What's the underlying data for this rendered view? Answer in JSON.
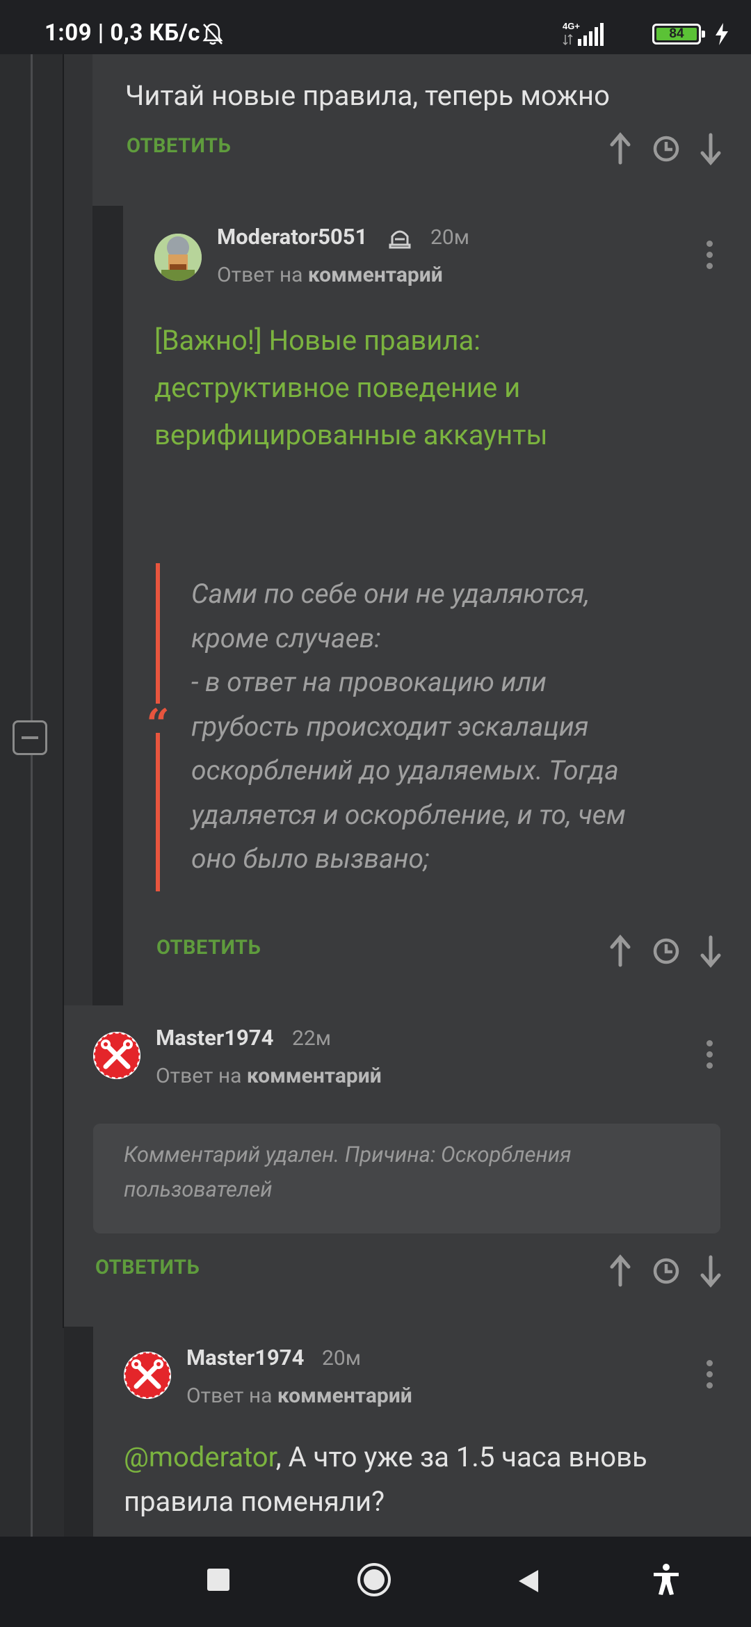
{
  "status_bar": {
    "time_speed": "1:09 | 0,3 КБ/с",
    "network": "4G+",
    "battery": "84",
    "icons": [
      "bell-off-icon",
      "signal-icon",
      "battery-icon",
      "charging-icon"
    ]
  },
  "top_comment": {
    "text": "Читай новые правила, теперь можно",
    "reply_label": "ОТВЕТИТЬ"
  },
  "moderator_comment": {
    "username": "Moderator5051",
    "time": "20м",
    "reply_prefix": "Ответ на",
    "reply_target": "комментарий",
    "link_text": "[Важно!] Новые правила: деструктивное поведение и верифицированные аккаунты",
    "link_lines": [
      "[Важно!] Новые правила:",
      "деструктивное поведение и",
      "верифицированные аккаунты"
    ],
    "quote_lines": [
      "Сами по себе они не удаляются,",
      "кроме случаев:",
      "- в ответ на провокацию или",
      "грубость происходит эскалация",
      "оскорблений до удаляемых. Тогда",
      "удаляется и оскорбление, и то, чем",
      "оно было вызвано;"
    ],
    "reply_label": "ОТВЕТИТЬ"
  },
  "master_comment_1": {
    "username": "Master1974",
    "time": "22м",
    "reply_prefix": "Ответ на",
    "reply_target": "комментарий",
    "deleted_line1": "Комментарий удален. Причина: Оскорбления",
    "deleted_line2": "пользователей",
    "reply_label": "ОТВЕТИТЬ"
  },
  "master_comment_2": {
    "username": "Master1974",
    "time": "20м",
    "reply_prefix": "Ответ на",
    "reply_target": "комментарий",
    "mention": "@moderator",
    "text_line1": ", А что уже за 1.5 часа вновь",
    "text_line2": "правила поменяли?"
  },
  "colors": {
    "accent_green": "#5f9c3d",
    "link_green": "#7bb33f",
    "quote_bar": "#e8553e",
    "panel_bg": "#3a3b3d",
    "page_bg": "#2c2d2f"
  }
}
